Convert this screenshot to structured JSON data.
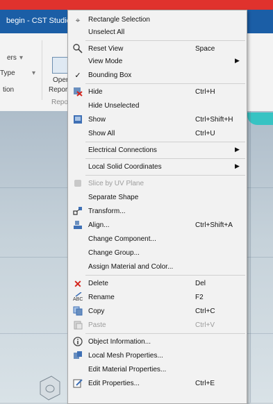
{
  "app": {
    "title": "begin - CST Studio"
  },
  "ribbon": {
    "labels": [
      "ers",
      "Type",
      "tion",
      "Oper",
      "Repor",
      "Repor"
    ]
  },
  "menu": {
    "items": [
      {
        "label": "Rectangle Selection",
        "shortcut": "",
        "icon": "rectangle-selection-icon",
        "disabled": false,
        "submenu": false
      },
      {
        "label": "Unselect All",
        "shortcut": "",
        "icon": "",
        "disabled": false,
        "submenu": false
      },
      {
        "label": "Reset View",
        "shortcut": "Space",
        "icon": "reset-view-icon",
        "disabled": false,
        "submenu": false
      },
      {
        "label": "View Mode",
        "shortcut": "",
        "icon": "",
        "disabled": false,
        "submenu": true
      },
      {
        "label": "Bounding Box",
        "shortcut": "",
        "icon": "checkmark-icon",
        "disabled": false,
        "submenu": false
      },
      {
        "label": "Hide",
        "shortcut": "Ctrl+H",
        "icon": "hide-icon",
        "disabled": false,
        "submenu": false
      },
      {
        "label": "Hide Unselected",
        "shortcut": "",
        "icon": "",
        "disabled": false,
        "submenu": false
      },
      {
        "label": "Show",
        "shortcut": "Ctrl+Shift+H",
        "icon": "show-icon",
        "disabled": false,
        "submenu": false
      },
      {
        "label": "Show All",
        "shortcut": "Ctrl+U",
        "icon": "",
        "disabled": false,
        "submenu": false
      },
      {
        "label": "Electrical Connections",
        "shortcut": "",
        "icon": "",
        "disabled": false,
        "submenu": true
      },
      {
        "label": "Local Solid Coordinates",
        "shortcut": "",
        "icon": "",
        "disabled": false,
        "submenu": true
      },
      {
        "label": "Slice by UV Plane",
        "shortcut": "",
        "icon": "slice-icon",
        "disabled": true,
        "submenu": false
      },
      {
        "label": "Separate Shape",
        "shortcut": "",
        "icon": "",
        "disabled": false,
        "submenu": false
      },
      {
        "label": "Transform...",
        "shortcut": "",
        "icon": "transform-icon",
        "disabled": false,
        "submenu": false
      },
      {
        "label": "Align...",
        "shortcut": "Ctrl+Shift+A",
        "icon": "align-icon",
        "disabled": false,
        "submenu": false
      },
      {
        "label": "Change Component...",
        "shortcut": "",
        "icon": "",
        "disabled": false,
        "submenu": false
      },
      {
        "label": "Change Group...",
        "shortcut": "",
        "icon": "",
        "disabled": false,
        "submenu": false
      },
      {
        "label": "Assign Material and Color...",
        "shortcut": "",
        "icon": "",
        "disabled": false,
        "submenu": false
      },
      {
        "label": "Delete",
        "shortcut": "Del",
        "icon": "delete-icon",
        "disabled": false,
        "submenu": false
      },
      {
        "label": "Rename",
        "shortcut": "F2",
        "icon": "rename-icon",
        "disabled": false,
        "submenu": false
      },
      {
        "label": "Copy",
        "shortcut": "Ctrl+C",
        "icon": "copy-icon",
        "disabled": false,
        "submenu": false
      },
      {
        "label": "Paste",
        "shortcut": "Ctrl+V",
        "icon": "paste-icon",
        "disabled": true,
        "submenu": false
      },
      {
        "label": "Object Information...",
        "shortcut": "",
        "icon": "info-icon",
        "disabled": false,
        "submenu": false
      },
      {
        "label": "Local Mesh Properties...",
        "shortcut": "",
        "icon": "mesh-icon",
        "disabled": false,
        "submenu": false
      },
      {
        "label": "Edit Material Properties...",
        "shortcut": "",
        "icon": "",
        "disabled": false,
        "submenu": false
      },
      {
        "label": "Edit Properties...",
        "shortcut": "Ctrl+E",
        "icon": "edit-properties-icon",
        "disabled": false,
        "submenu": false
      }
    ]
  },
  "colors": {
    "accent_bar": "#e0322d",
    "titlebar": "#1b5ea6",
    "menu_bg": "#f2f2f2",
    "delete_red": "#d4241c"
  }
}
